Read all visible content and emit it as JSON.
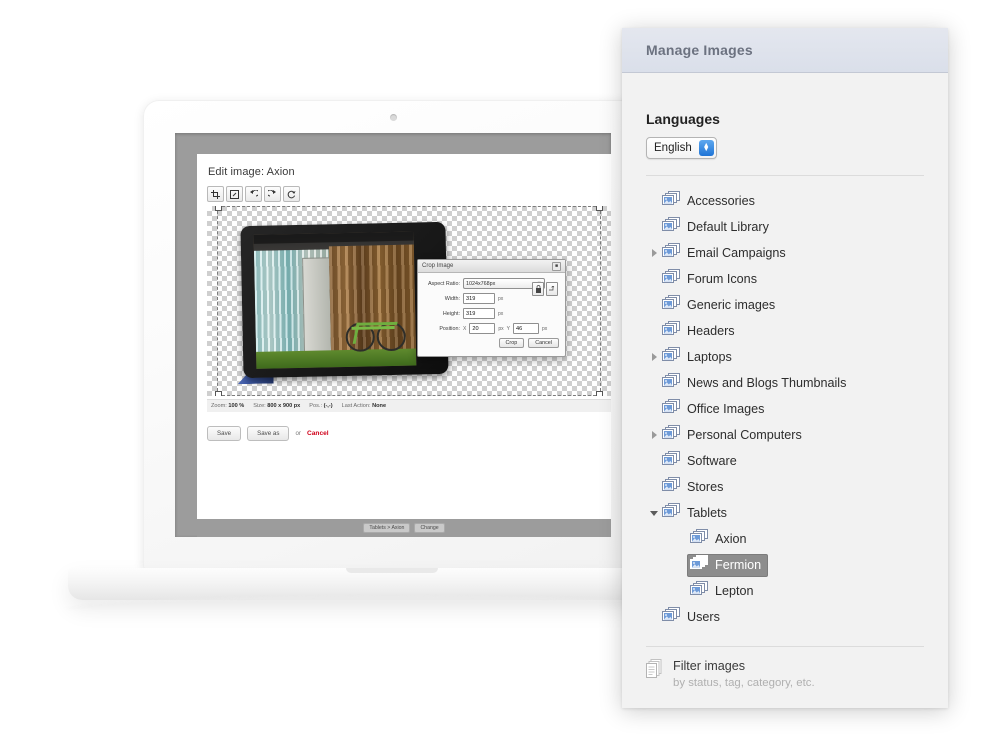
{
  "panel": {
    "header_title": "Manage Images",
    "languages_heading": "Languages",
    "language_selected": "English",
    "tree_items": [
      {
        "label": "Accessories",
        "expandable": false,
        "expanded": false,
        "child": false,
        "selected": false
      },
      {
        "label": "Default Library",
        "expandable": false,
        "expanded": false,
        "child": false,
        "selected": false
      },
      {
        "label": "Email Campaigns",
        "expandable": true,
        "expanded": false,
        "child": false,
        "selected": false
      },
      {
        "label": "Forum Icons",
        "expandable": false,
        "expanded": false,
        "child": false,
        "selected": false
      },
      {
        "label": "Generic images",
        "expandable": false,
        "expanded": false,
        "child": false,
        "selected": false
      },
      {
        "label": "Headers",
        "expandable": false,
        "expanded": false,
        "child": false,
        "selected": false
      },
      {
        "label": "Laptops",
        "expandable": true,
        "expanded": false,
        "child": false,
        "selected": false
      },
      {
        "label": "News and Blogs Thumbnails",
        "expandable": false,
        "expanded": false,
        "child": false,
        "selected": false
      },
      {
        "label": "Office Images",
        "expandable": false,
        "expanded": false,
        "child": false,
        "selected": false
      },
      {
        "label": "Personal Computers",
        "expandable": true,
        "expanded": false,
        "child": false,
        "selected": false
      },
      {
        "label": "Software",
        "expandable": false,
        "expanded": false,
        "child": false,
        "selected": false
      },
      {
        "label": "Stores",
        "expandable": false,
        "expanded": false,
        "child": false,
        "selected": false
      },
      {
        "label": "Tablets",
        "expandable": true,
        "expanded": true,
        "child": false,
        "selected": false
      },
      {
        "label": "Axion",
        "expandable": false,
        "expanded": false,
        "child": true,
        "selected": false
      },
      {
        "label": "Fermion",
        "expandable": false,
        "expanded": false,
        "child": true,
        "selected": true
      },
      {
        "label": "Lepton",
        "expandable": false,
        "expanded": false,
        "child": true,
        "selected": false
      },
      {
        "label": "Users",
        "expandable": false,
        "expanded": false,
        "child": false,
        "selected": false
      }
    ],
    "filter_title": "Filter images",
    "filter_subtitle": "by status, tag, category, etc."
  },
  "editor": {
    "title": "Edit image: Axion",
    "toolbar": [
      {
        "name": "crop-tool",
        "glyph": "crop"
      },
      {
        "name": "resize-tool",
        "glyph": "resize"
      },
      {
        "name": "rotate-left-tool",
        "glyph": "rotate-left"
      },
      {
        "name": "rotate-right-tool",
        "glyph": "rotate-right"
      },
      {
        "name": "reset-tool",
        "glyph": "reset"
      }
    ],
    "status": {
      "zoom_label": "Zoom:",
      "zoom_value": "100 %",
      "size_label": "Size:",
      "size_value": "800 x 900 px",
      "pos_label": "Pos.:",
      "pos_value": "(-,-)",
      "action_label": "Last Action:",
      "action_value": "None"
    },
    "actions": {
      "save": "Save",
      "save_as": "Save as",
      "or": "or",
      "cancel": "Cancel"
    },
    "breadcrumb": {
      "path": "Tablets > Axion",
      "change": "Change"
    }
  },
  "crop_dialog": {
    "title": "Crop Image",
    "close": "■",
    "aspect_ratio_label": "Aspect Ratio:",
    "aspect_ratio_value": "1024x768px",
    "width_label": "Width:",
    "width_value": "319",
    "height_label": "Height:",
    "height_value": "319",
    "position_label": "Position:",
    "x_label": "X",
    "x_value": "20",
    "y_label": "Y",
    "y_value": "46",
    "unit": "px",
    "crop_button": "Crop",
    "cancel_button": "Cancel"
  },
  "colors": {
    "panel_header": "#dadfea",
    "selection": "#8d8d8d",
    "cancel_red": "#d0021b",
    "stepper_blue": "#1f74d6"
  }
}
